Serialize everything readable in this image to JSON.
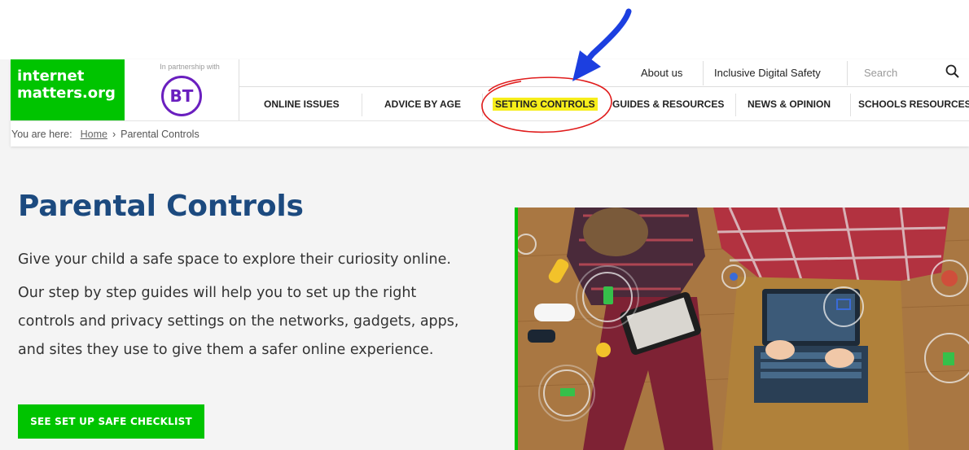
{
  "brand": {
    "logo_line1": "internet",
    "logo_line2": "matters.org",
    "partner_text": "In partnership with",
    "partner_logo_text": "BT"
  },
  "utility_nav": {
    "about_label": "About us",
    "inclusive_label": "Inclusive Digital Safety",
    "search_placeholder": "Search",
    "search_icon": "magnifier-icon"
  },
  "main_nav": {
    "items": [
      {
        "label": "ONLINE ISSUES"
      },
      {
        "label": "ADVICE BY AGE"
      },
      {
        "label": "SETTING CONTROLS",
        "highlighted": true
      },
      {
        "label": "GUIDES & RESOURCES"
      },
      {
        "label": "NEWS & OPINION"
      },
      {
        "label": "SCHOOLS RESOURCES"
      }
    ]
  },
  "breadcrumb": {
    "prefix": "You are here:",
    "home": "Home",
    "separator": "›",
    "current": "Parental Controls"
  },
  "hero": {
    "title": "Parental Controls",
    "intro": "Give your child a safe space to explore their curiosity online.",
    "description": "Our step by step guides will help you to set up the right controls and privacy settings on the networks, gadgets, apps, and sites they use to give them a safer online experience.",
    "cta_label": "SEE SET UP SAFE CHECKLIST"
  },
  "colors": {
    "brand_green": "#00c400",
    "title_blue": "#1c4a7f",
    "bt_purple": "#6a1fbf",
    "highlight_yellow": "#f7ee1b",
    "annotation_red": "#e01c1c",
    "annotation_blue": "#1c3fe0"
  }
}
